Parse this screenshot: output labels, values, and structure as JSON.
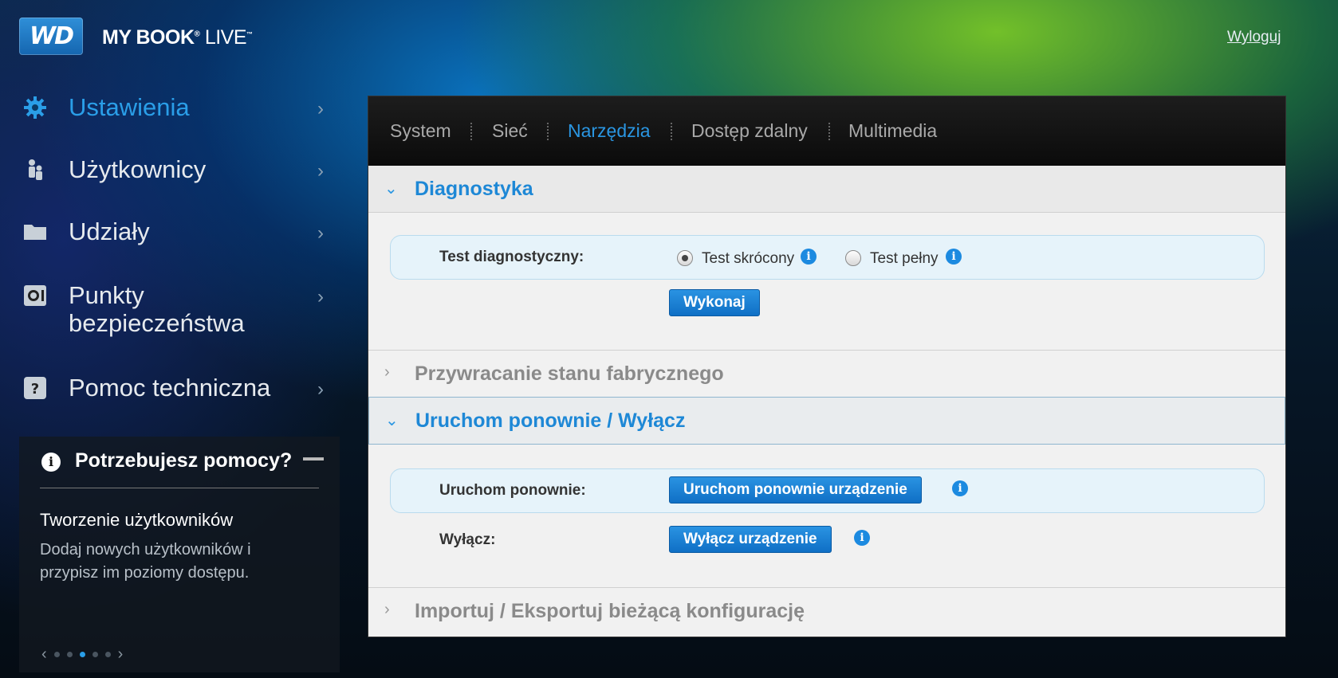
{
  "header": {
    "logo_text": "WD",
    "product_name": "MY BOOK",
    "product_suffix": "LIVE",
    "logout": "Wyloguj"
  },
  "sidebar": {
    "items": [
      {
        "label": "Ustawienia",
        "icon": "gear-icon",
        "active": true
      },
      {
        "label": "Użytkownicy",
        "icon": "users-icon",
        "active": false
      },
      {
        "label": "Udziały",
        "icon": "folder-icon",
        "active": false
      },
      {
        "label": "Punkty bezpieczeństwa",
        "icon": "safepoint-icon",
        "active": false
      },
      {
        "label": "Pomoc techniczna",
        "icon": "question-icon",
        "active": false
      }
    ]
  },
  "help": {
    "title": "Potrzebujesz pomocy?",
    "subtitle": "Tworzenie użytkowników",
    "text": "Dodaj nowych użytkowników i przypisz im poziomy dostępu.",
    "pager_total": 5,
    "pager_active": 3
  },
  "tabs": [
    "System",
    "Sieć",
    "Narzędzia",
    "Dostęp zdalny",
    "Multimedia"
  ],
  "active_tab": "Narzędzia",
  "sections": {
    "diagnostics": {
      "title": "Diagnostyka",
      "test_label": "Test diagnostyczny:",
      "option_short": "Test skrócony",
      "option_full": "Test pełny",
      "selected": "Test skrócony",
      "run_button": "Wykonaj"
    },
    "factory_reset": {
      "title": "Przywracanie stanu fabrycznego"
    },
    "restart": {
      "title": "Uruchom ponownie / Wyłącz",
      "restart_label": "Uruchom ponownie:",
      "restart_button": "Uruchom ponownie urządzenie",
      "shutdown_label": "Wyłącz:",
      "shutdown_button": "Wyłącz urządzenie"
    },
    "import_export": {
      "title": "Importuj / Eksportuj bieżącą konfigurację"
    }
  },
  "colors": {
    "accent": "#2a96e2",
    "button": "#1c80d4",
    "panel_bg": "#f1f1f1"
  }
}
